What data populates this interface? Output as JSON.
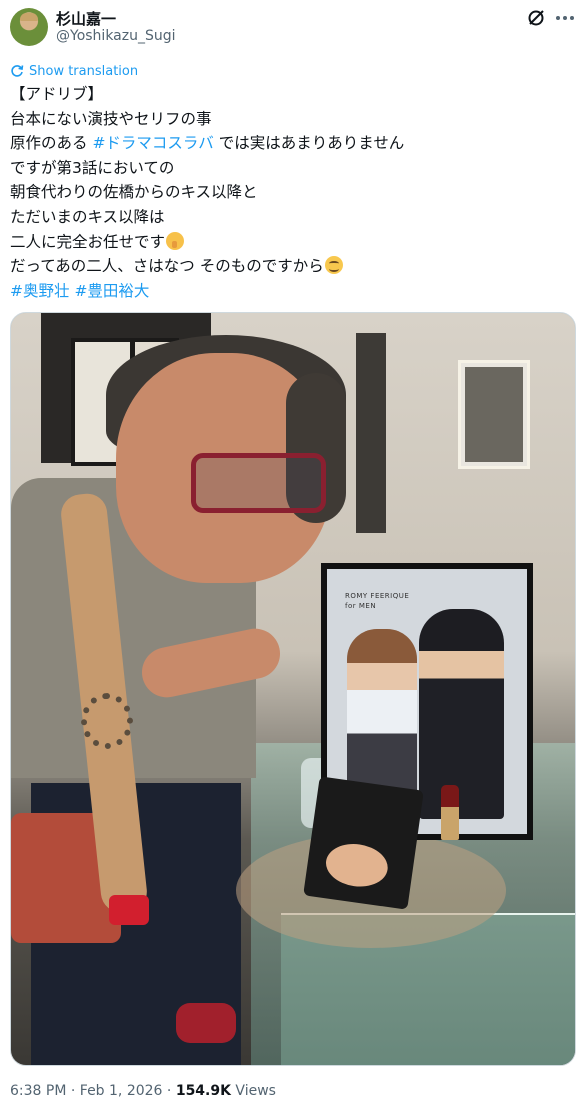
{
  "author": {
    "display_name": "杉山嘉一",
    "handle": "@Yoshikazu_Sugi"
  },
  "icons": {
    "avatar": "avatar",
    "grok": "grok-icon",
    "translate": "translate-icon",
    "more": "more-icon"
  },
  "translation_link": "Show translation",
  "tweet": {
    "line1": "【アドリブ】",
    "line2": "台本にない演技やセリフの事",
    "line3_pre": "原作のある ",
    "line3_tag": "#ドラマコスラバ",
    "line3_post": " では実はあまりありません",
    "line4": "ですが第3話においての",
    "line5": "朝食代わりの佐橋からのキス以降と",
    "line6": "ただいまのキス以降は",
    "line7": "二人に完全お任せです",
    "line8": "だってあの二人、さはなつ そのものですから",
    "tag1": "#奥野壮",
    "tag2": "#豊田裕大"
  },
  "photo": {
    "poster_text_line1": "ROMY FEERIQUE",
    "poster_text_line2": "for MEN"
  },
  "meta": {
    "time": "6:38 PM",
    "separator": " · ",
    "date": "Feb 1, 2026",
    "views_count": "154.9K",
    "views_label": " Views"
  },
  "colors": {
    "link": "#1d9bf0",
    "text": "#0f1419",
    "secondary": "#536471"
  }
}
